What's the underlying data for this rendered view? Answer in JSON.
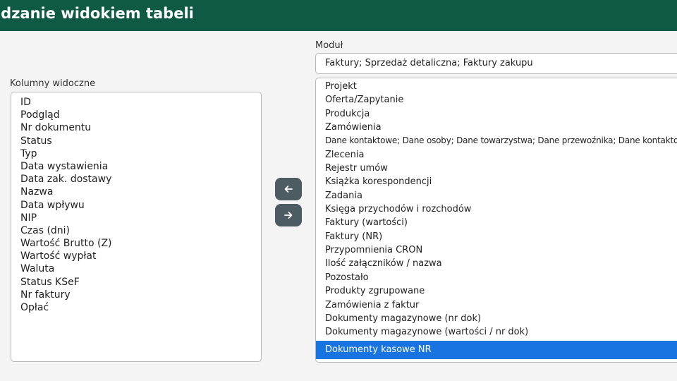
{
  "header": {
    "title": "ądzanie widokiem tabeli"
  },
  "visible_columns": {
    "label": "Kolumny widoczne",
    "items": [
      "ID",
      "Podgląd",
      "Nr dokumentu",
      "Status",
      "Typ",
      "Data wystawienia",
      "Data zak. dostawy",
      "Nazwa",
      "Data wpływu",
      "NIP",
      "Czas (dni)",
      "Wartość Brutto (Z)",
      "Wartość wypłat",
      "Waluta",
      "Status KSeF",
      "Nr faktury",
      "Opłać"
    ]
  },
  "module": {
    "label": "Moduł",
    "value": "Faktury; Sprzedaż detaliczna; Faktury zakupu"
  },
  "available_columns": {
    "items": [
      "Projekt",
      "Oferta/Zapytanie",
      "Produkcja",
      "Zamówienia",
      "Dane kontaktowe; Dane osoby; Dane towarzystwa; Dane przewoźnika; Dane kontaktowe (",
      "Zlecenia",
      "Rejestr umów",
      "Książka korespondencji",
      "Zadania",
      "Księga przychodów i rozchodów",
      "Faktury (wartości)",
      "Faktury (NR)",
      "Przypomnienia CRON",
      "Ilość załączników / nazwa",
      "Pozostało",
      "Produkty zgrupowane",
      "Zamówienia z faktur",
      "Dokumenty magazynowe (nr dok)",
      "Dokumenty magazynowe (wartości / nr dok)",
      "Dokumenty kasowe NR"
    ],
    "selected": "Dokumenty kasowe NR"
  },
  "buttons": {
    "move_left_icon": "arrow-left-icon",
    "move_right_icon": "arrow-right-icon"
  },
  "colors": {
    "header": "#0f5a44",
    "selection": "#1874e0",
    "button": "#4d5b62"
  }
}
